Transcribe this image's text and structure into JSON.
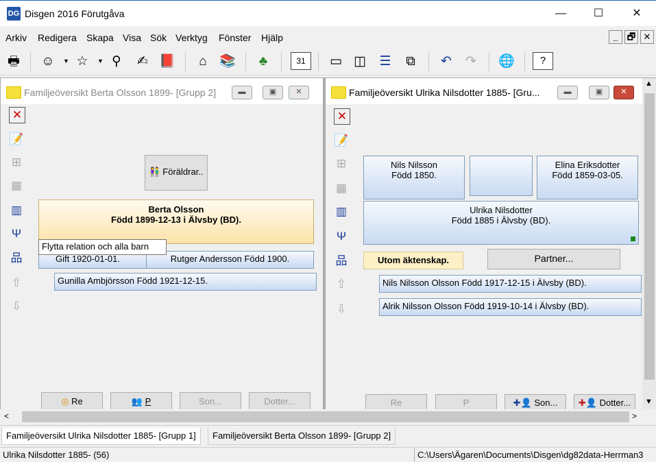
{
  "window": {
    "title": "Disgen 2016 Förutgåva",
    "icon_label": "DG"
  },
  "window_controls": {
    "minimize": "—",
    "maximize": "☐",
    "close": "✕"
  },
  "menu": [
    "Arkiv",
    "Redigera",
    "Skapa",
    "Visa",
    "Sök",
    "Verktyg",
    "Fönster",
    "Hjälp"
  ],
  "mdi_controls": {
    "minimize": "_",
    "restore": "🗗",
    "close": "✕"
  },
  "left_window": {
    "title": "Familjeöversikt Berta Olsson 1899- [Grupp 2]",
    "parents_button": "Föräldrar..",
    "main_person_name": "Berta Olsson",
    "main_person_birth": "Född 1899-12-13 i Älvsby (BD).",
    "tooltip": "Flytta relation och alla barn",
    "marriage": "Gift 1920-01-01.",
    "partner": "Rutger Andersson Född 1900.",
    "children": [
      "Gunilla Ambjörsson Född 1921-12-15."
    ],
    "bottom_buttons": [
      "Re",
      "P",
      "Son...",
      "Dotter..."
    ]
  },
  "right_window": {
    "title": "Familjeöversikt Ulrika Nilsdotter 1885- [Gru...",
    "father_name": "Nils Nilsson",
    "father_birth": "Född 1850.",
    "mother_name": "Elina Eriksdotter",
    "mother_birth": "Född 1859-03-05.",
    "main_person_name": "Ulrika Nilsdotter",
    "main_person_birth": "Född 1885 i Älvsby (BD).",
    "relation_label": "Utom äktenskap.",
    "partner_button": "Partner...",
    "children": [
      "Nils Nilsson Olsson Född 1917-12-15 i Älvsby (BD).",
      "Alrik Nilsson Olsson Född 1919-10-14 i Älvsby (BD)."
    ],
    "bottom_buttons": [
      "Re",
      "P",
      "Son...",
      "Dotter..."
    ]
  },
  "tabs": [
    "Familjeöversikt Ulrika Nilsdotter 1885- [Grupp 1]",
    "Familjeöversikt Berta Olsson 1899- [Grupp 2]"
  ],
  "status": {
    "left": "Ulrika Nilsdotter 1885- (56)",
    "right": "C:\\Users\\Ägaren\\Documents\\Disgen\\dg82data-Herrman3"
  },
  "colors": {
    "accent": "#1e6ab4",
    "main_person_bg": "#fce8b8",
    "box_bg": "#c8daf2",
    "relation_bg": "#fdf0c6"
  }
}
